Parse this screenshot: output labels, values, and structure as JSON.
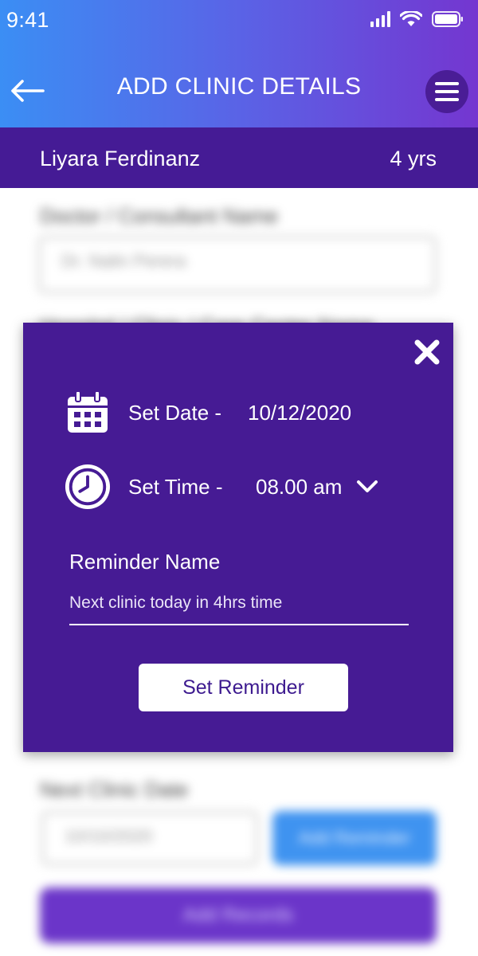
{
  "status_bar": {
    "time": "9:41"
  },
  "header": {
    "title": "ADD CLINIC DETAILS"
  },
  "patient": {
    "name": "Liyara Ferdinanz",
    "age": "4 yrs"
  },
  "background_form": {
    "doctor_label": "Doctor / Consultant Name",
    "doctor_value": "Dr. Nalin Perera",
    "hospital_label": "Hospital / Clinic / Care Center Name",
    "next_clinic_label": "Next Clinic Date",
    "next_clinic_value": "10/10/2020",
    "add_reminder_label": "Add Reminder",
    "add_records_label": "Add Records"
  },
  "modal": {
    "date_label": "Set Date -",
    "date_value": "10/12/2020",
    "time_label": "Set Time -",
    "time_value": "08.00 am",
    "reminder_label": "Reminder Name",
    "reminder_value": "Next clinic today in 4hrs time",
    "set_reminder_label": "Set Reminder"
  },
  "colors": {
    "header_gradient_start": "#3b8ef4",
    "header_gradient_end": "#7436d0",
    "brand_purple": "#451b95",
    "modal_bg": "#461b94",
    "accent_blue": "#3f93f0"
  },
  "icons": {
    "back": "arrow-left-icon",
    "menu": "hamburger-menu-icon",
    "close": "close-icon",
    "date": "calendar-icon",
    "time": "clock-icon",
    "dropdown": "chevron-down-icon"
  }
}
